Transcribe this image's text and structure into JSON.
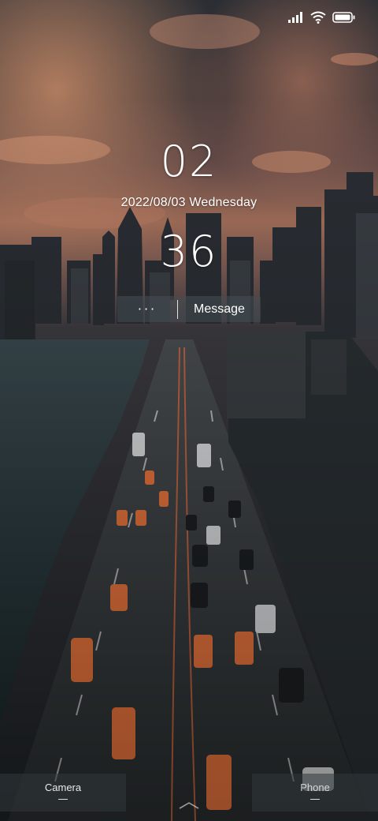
{
  "status_bar": {
    "icons": [
      "cellular-signal-icon",
      "wifi-icon",
      "battery-icon"
    ]
  },
  "lock_screen": {
    "clock_hour": "02",
    "clock_minute": "36",
    "date": "2022/08/03 Wednesday"
  },
  "notification": {
    "more_label": "···",
    "message_label": "Message"
  },
  "shortcuts": {
    "camera_label": "Camera",
    "phone_label": "Phone"
  },
  "swipe_icon": "chevron-up-icon"
}
